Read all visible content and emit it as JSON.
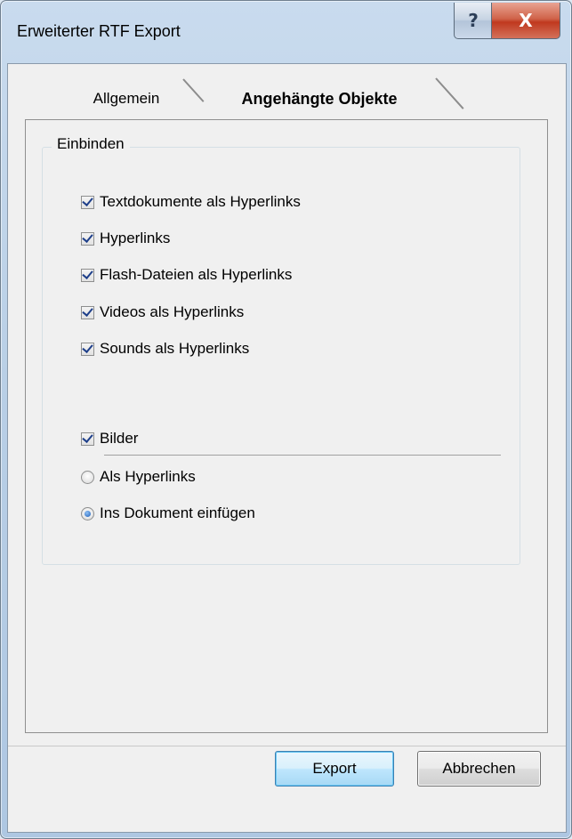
{
  "window": {
    "title": "Erweiterter RTF Export",
    "help_label": "?",
    "close_label": "X"
  },
  "tabs": [
    {
      "label": "Allgemein",
      "active": false
    },
    {
      "label": "Angehängte Objekte",
      "active": true
    }
  ],
  "group": {
    "title": "Einbinden",
    "checkboxes": [
      {
        "label": "Textdokumente als Hyperlinks",
        "checked": true
      },
      {
        "label": "Hyperlinks",
        "checked": true
      },
      {
        "label": "Flash-Dateien als Hyperlinks",
        "checked": true
      },
      {
        "label": "Videos als Hyperlinks",
        "checked": true
      },
      {
        "label": "Sounds als Hyperlinks",
        "checked": true
      }
    ],
    "images": {
      "label": "Bilder",
      "checked": true
    },
    "radios": [
      {
        "label": "Als Hyperlinks",
        "selected": false
      },
      {
        "label": "Ins Dokument einfügen",
        "selected": true
      }
    ]
  },
  "buttons": {
    "export": "Export",
    "cancel": "Abbrechen"
  }
}
